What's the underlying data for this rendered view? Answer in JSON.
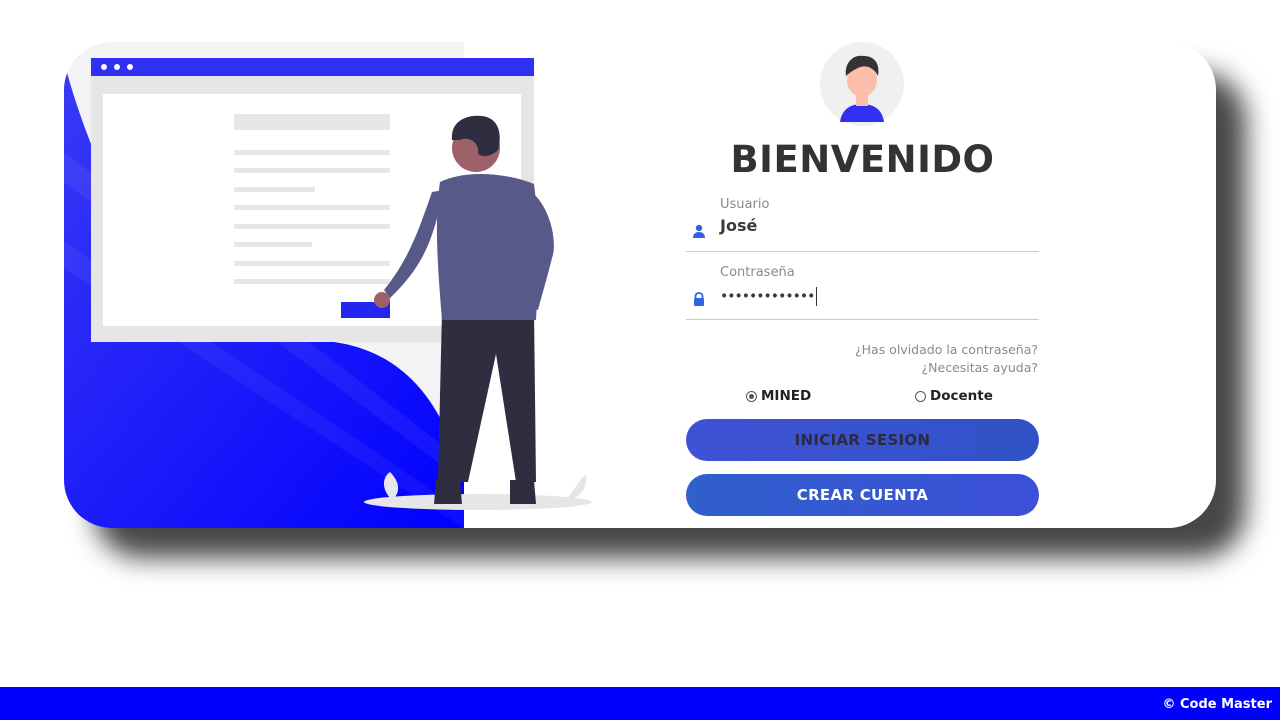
{
  "colors": {
    "brand_blue": "#0000ff",
    "button_blue": "#3d52d5",
    "text_dark": "#333333",
    "muted": "#8a8a8a"
  },
  "login": {
    "title": "BIENVENIDO",
    "username": {
      "label": "Usuario",
      "value": "José",
      "icon": "user-icon"
    },
    "password": {
      "label": "Contraseña",
      "value": "•••••••••••••",
      "icon": "lock-icon"
    },
    "forgot_password": "¿Has olvidado la contraseña?",
    "need_help": "¿Necesitas ayuda?",
    "roles": [
      {
        "label": "MINED",
        "selected": true
      },
      {
        "label": "Docente",
        "selected": false
      }
    ],
    "login_button": "INICIAR SESION",
    "create_account_button": "CREAR CUENTA"
  },
  "footer": {
    "text": "© Code Master"
  }
}
